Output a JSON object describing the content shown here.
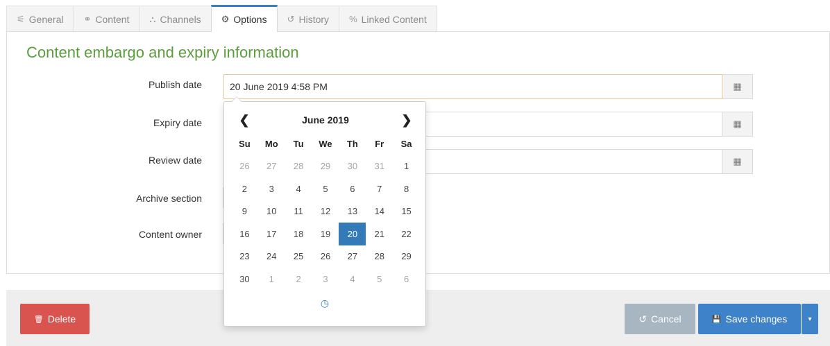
{
  "tabs": [
    {
      "label": "General",
      "icon": "sliders-icon",
      "glyph": "⚟"
    },
    {
      "label": "Content",
      "icon": "content-icon",
      "glyph": "⚭"
    },
    {
      "label": "Channels",
      "icon": "sitemap-icon",
      "glyph": "⛬"
    },
    {
      "label": "Options",
      "icon": "cogs-icon",
      "glyph": "⚙"
    },
    {
      "label": "History",
      "icon": "history-icon",
      "glyph": "↺"
    },
    {
      "label": "Linked Content",
      "icon": "link-icon",
      "glyph": "%"
    }
  ],
  "active_tab": "Options",
  "section_title": "Content embargo and expiry information",
  "fields": {
    "publish_label": "Publish date",
    "publish_value": "20 June 2019 4:58 PM",
    "expiry_label": "Expiry date",
    "expiry_value": "",
    "review_label": "Review date",
    "review_value": "",
    "archive_label": "Archive section",
    "owner_label": "Content owner"
  },
  "calendar_glyph": "▦",
  "datepicker": {
    "prev_glyph": "❮",
    "next_glyph": "❯",
    "title": "June 2019",
    "weekdays": [
      "Su",
      "Mo",
      "Tu",
      "We",
      "Th",
      "Fr",
      "Sa"
    ],
    "days": [
      {
        "d": "26",
        "other": true
      },
      {
        "d": "27",
        "other": true
      },
      {
        "d": "28",
        "other": true
      },
      {
        "d": "29",
        "other": true
      },
      {
        "d": "30",
        "other": true
      },
      {
        "d": "31",
        "other": true
      },
      {
        "d": "1",
        "other": false
      },
      {
        "d": "2",
        "other": false
      },
      {
        "d": "3",
        "other": false
      },
      {
        "d": "4",
        "other": false
      },
      {
        "d": "5",
        "other": false
      },
      {
        "d": "6",
        "other": false
      },
      {
        "d": "7",
        "other": false
      },
      {
        "d": "8",
        "other": false
      },
      {
        "d": "9",
        "other": false
      },
      {
        "d": "10",
        "other": false
      },
      {
        "d": "11",
        "other": false
      },
      {
        "d": "12",
        "other": false
      },
      {
        "d": "13",
        "other": false
      },
      {
        "d": "14",
        "other": false
      },
      {
        "d": "15",
        "other": false
      },
      {
        "d": "16",
        "other": false
      },
      {
        "d": "17",
        "other": false
      },
      {
        "d": "18",
        "other": false
      },
      {
        "d": "19",
        "other": false
      },
      {
        "d": "20",
        "other": false,
        "selected": true
      },
      {
        "d": "21",
        "other": false
      },
      {
        "d": "22",
        "other": false
      },
      {
        "d": "23",
        "other": false
      },
      {
        "d": "24",
        "other": false
      },
      {
        "d": "25",
        "other": false
      },
      {
        "d": "26",
        "other": false
      },
      {
        "d": "27",
        "other": false
      },
      {
        "d": "28",
        "other": false
      },
      {
        "d": "29",
        "other": false
      },
      {
        "d": "30",
        "other": false
      },
      {
        "d": "1",
        "other": true
      },
      {
        "d": "2",
        "other": true
      },
      {
        "d": "3",
        "other": true
      },
      {
        "d": "4",
        "other": true
      },
      {
        "d": "5",
        "other": true
      },
      {
        "d": "6",
        "other": true
      }
    ],
    "time_glyph": "◷"
  },
  "footer": {
    "delete_label": "Delete",
    "delete_glyph": "🗑",
    "cancel_label": "Cancel",
    "cancel_glyph": "↺",
    "save_label": "Save changes",
    "save_glyph": "💾",
    "caret_glyph": "▾"
  },
  "colors": {
    "accent": "#337ab7",
    "title_green": "#5a9e3c",
    "delete_red": "#d9534f",
    "cancel_grey": "#a7b6c1",
    "save_blue": "#3e82c9"
  }
}
